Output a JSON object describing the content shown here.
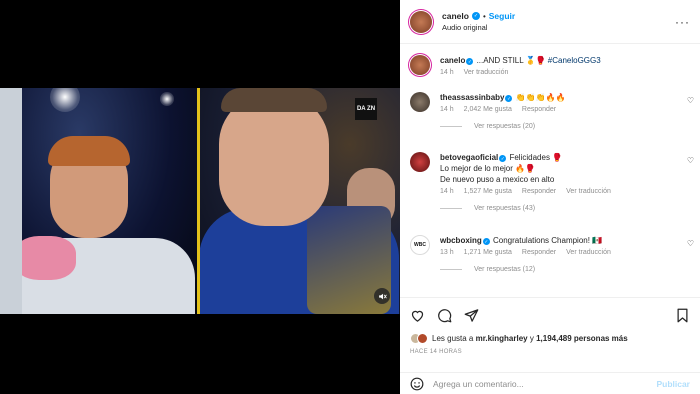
{
  "header": {
    "username": "canelo",
    "follow_label": "Seguir",
    "audio": "Audio original",
    "more": "···"
  },
  "video": {
    "dazn_logo": "DA ZN",
    "mute_icon": "🔇"
  },
  "caption": {
    "username": "canelo",
    "text": " ...AND STILL 🥇🥊 ",
    "hashtag": "#CaneloGGG3",
    "time": "14 h",
    "translate": "Ver traducción"
  },
  "comments": [
    {
      "username": "theassassinbaby",
      "text": " 👏👏👏🔥🔥",
      "time": "14 h",
      "likes": "2,042 Me gusta",
      "reply": "Responder",
      "view_replies": "Ver respuestas (20)"
    },
    {
      "username": "betovegaoficial",
      "text": " Felicidades 🥊",
      "line2": "Lo mejor de lo mejor 🔥🥊",
      "line3": "De nuevo puso a mexico en alto",
      "time": "14 h",
      "likes": "1,527 Me gusta",
      "reply": "Responder",
      "translate": "Ver traducción",
      "view_replies": "Ver respuestas (43)"
    },
    {
      "username": "wbcboxing",
      "text": " Congratulations Champion! 🇲🇽",
      "avatar_text": "WBC",
      "time": "13 h",
      "likes": "1,271 Me gusta",
      "reply": "Responder",
      "translate": "Ver traducción",
      "view_replies": "Ver respuestas (12)"
    }
  ],
  "likes": {
    "prefix": "Les gusta a ",
    "user": "mr.kingharley",
    "mid": " y ",
    "count": "1,194,489 personas más"
  },
  "time_ago": "HACE 14 HORAS",
  "comment_box": {
    "placeholder": "Agrega un comentario...",
    "post_label": "Publicar"
  },
  "colors": {
    "accent": "#0095f6",
    "post_disabled": "#b2dffc",
    "muted": "#8e8e8e"
  }
}
